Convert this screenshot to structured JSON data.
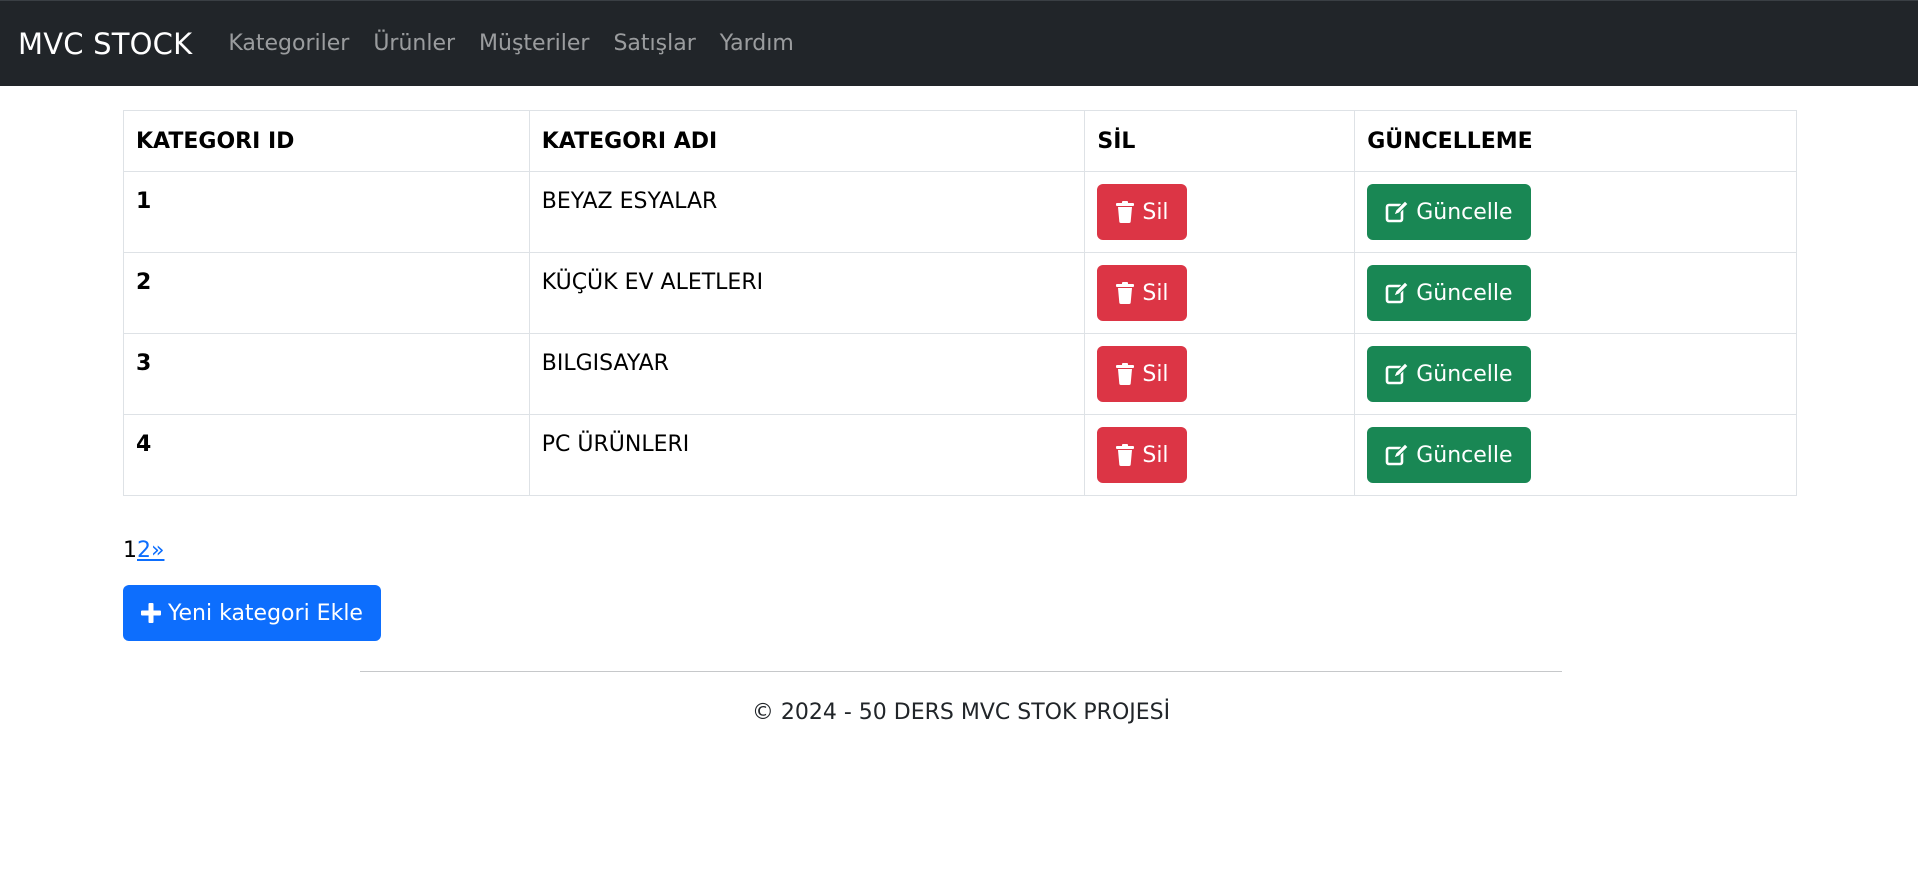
{
  "navbar": {
    "brand": "MVC STOCK",
    "links": [
      "Kategoriler",
      "Ürünler",
      "Müşteriler",
      "Satışlar",
      "Yardım"
    ]
  },
  "table": {
    "headers": [
      "KATEGORI ID",
      "KATEGORI ADI",
      "SİL",
      "GÜNCELLEME"
    ],
    "rows": [
      {
        "id": "1",
        "name": "BEYAZ ESYALAR"
      },
      {
        "id": "2",
        "name": "KÜÇÜK EV ALETLERI"
      },
      {
        "id": "3",
        "name": "BILGISAYAR"
      },
      {
        "id": "4",
        "name": "PC ÜRÜNLERI"
      }
    ],
    "delete_label": "Sil",
    "update_label": "Güncelle"
  },
  "pagination": {
    "current": "1",
    "next_page": "2",
    "next_arrow": "»"
  },
  "add_button": {
    "label": "Yeni kategori Ekle"
  },
  "footer": {
    "text": "© 2024 - 50 DERS MVC STOK PROJESİ"
  },
  "colors": {
    "navbar_bg": "#212529",
    "danger": "#dc3545",
    "success": "#198754",
    "primary": "#0d6efd"
  },
  "icons": {
    "delete": "trash-icon",
    "update": "edit-icon",
    "add": "plus-icon"
  }
}
